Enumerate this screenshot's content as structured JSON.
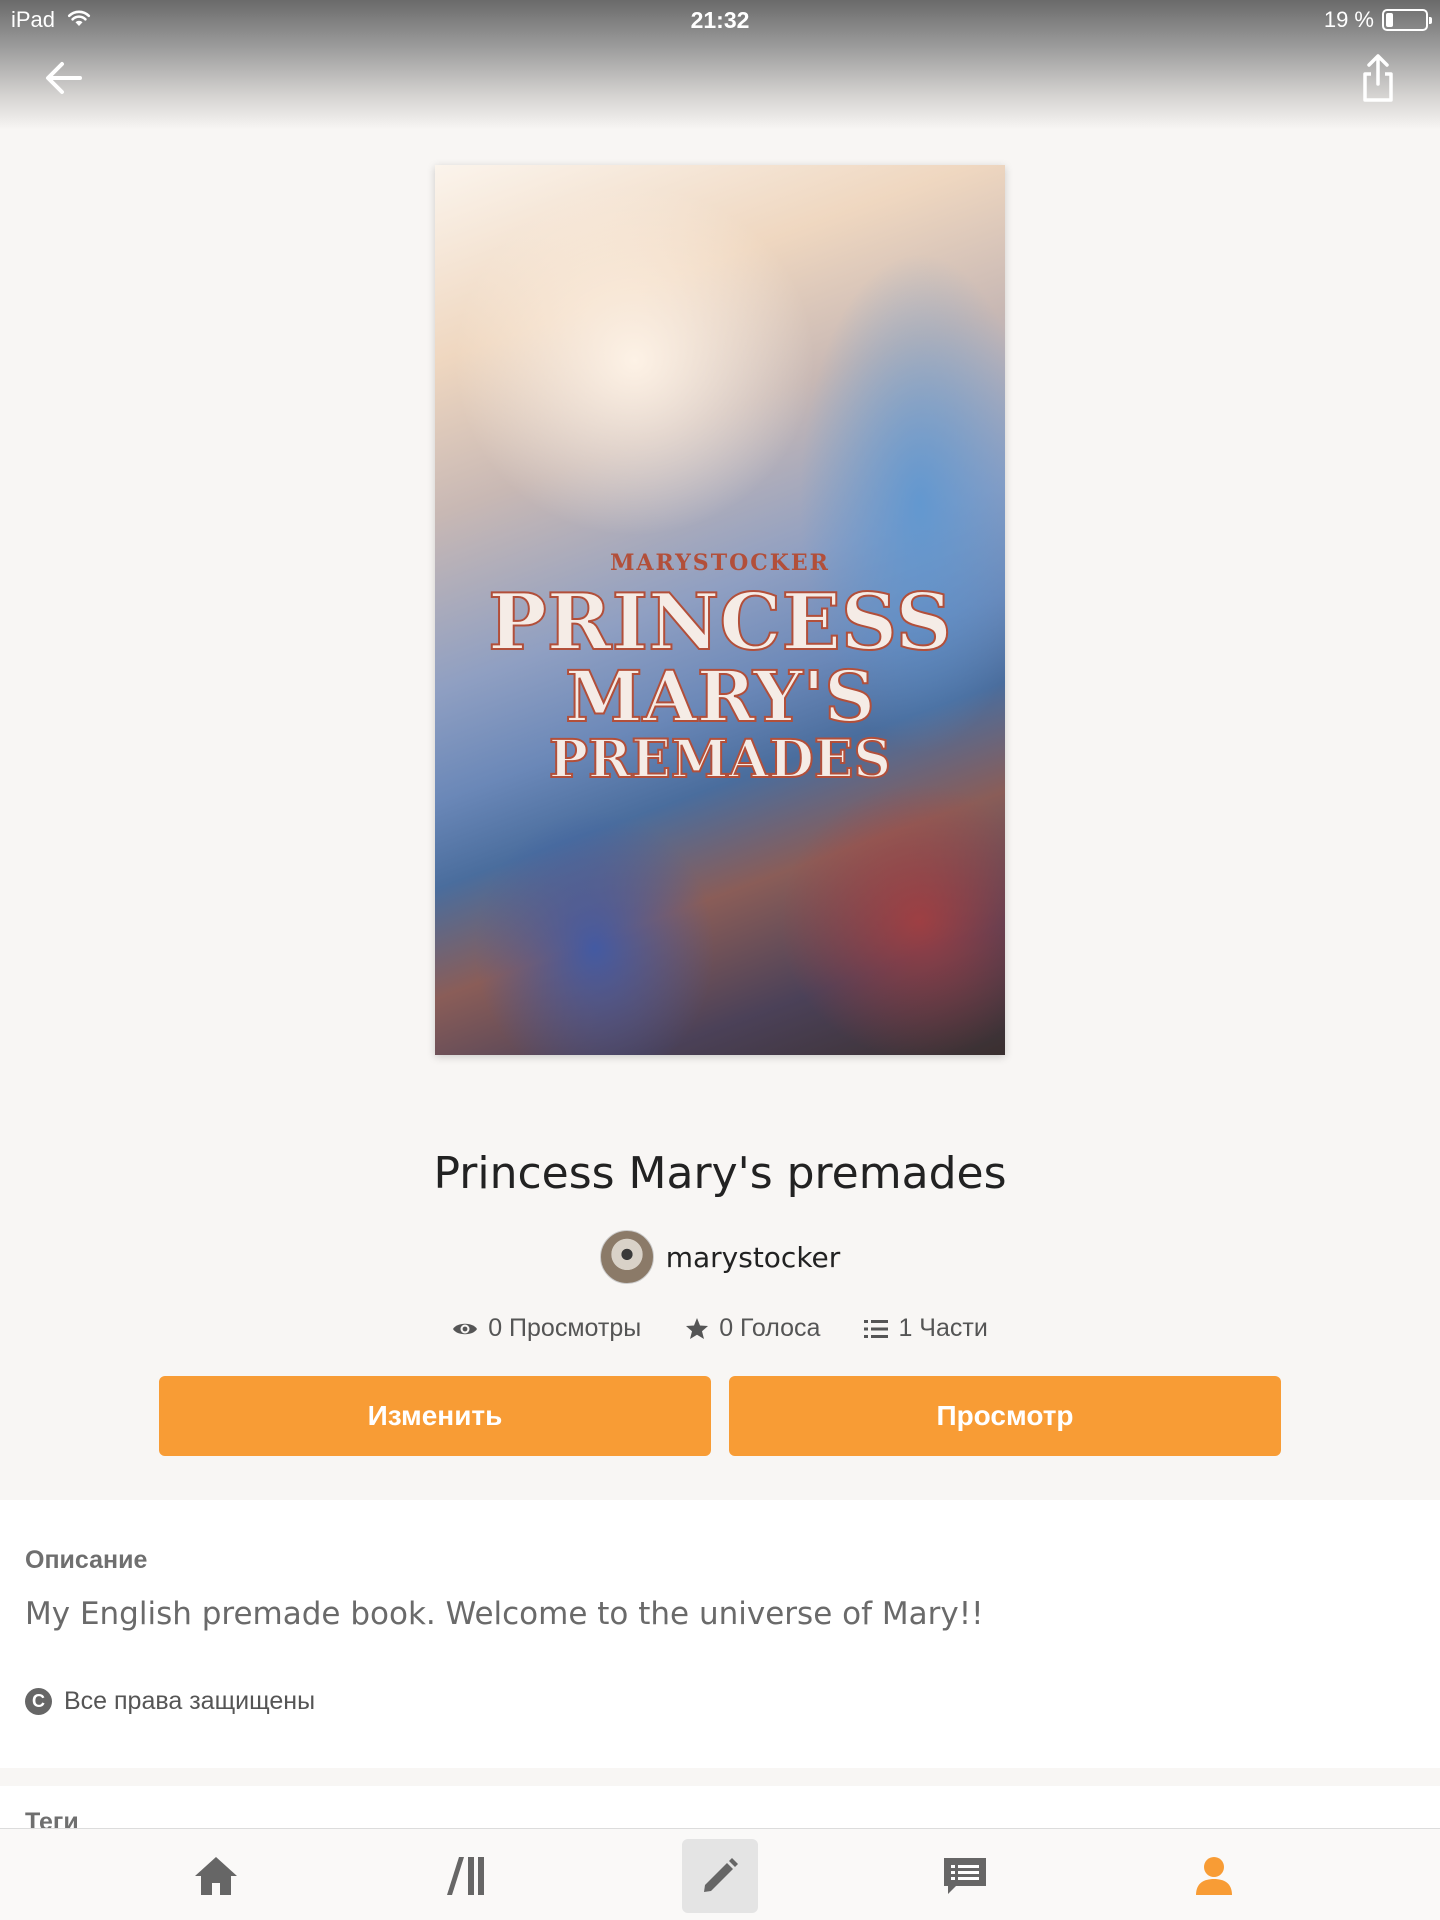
{
  "status_bar": {
    "device": "iPad",
    "time": "21:32",
    "battery": "19 %",
    "battery_level": 0.19
  },
  "nav": {
    "back_icon": "arrow-left-icon",
    "share_icon": "share-icon"
  },
  "cover": {
    "author": "MARYSTOCKER",
    "title_line_1": "PRINCESS",
    "title_line_2": "MARY'S",
    "title_line_3": "PREMADES"
  },
  "book": {
    "title": "Princess Mary's premades",
    "author": "marystocker"
  },
  "stats": {
    "views": "0 Просмотры",
    "votes": "0 Голоса",
    "parts": "1 Части"
  },
  "actions": {
    "edit_label": "Изменить",
    "preview_label": "Просмотр"
  },
  "description": {
    "heading": "Описание",
    "text": "My English premade book. Welcome to the universe of Mary!!",
    "rights": "Все права защищены"
  },
  "tags": {
    "heading": "Теги"
  },
  "tab_bar": {
    "items": [
      "home-icon",
      "library-icon",
      "write-icon",
      "messages-icon",
      "profile-icon"
    ],
    "active": "write-icon",
    "accent_color": "#f89c35"
  },
  "colors": {
    "accent": "#f89c35",
    "background": "#f8f6f4"
  }
}
